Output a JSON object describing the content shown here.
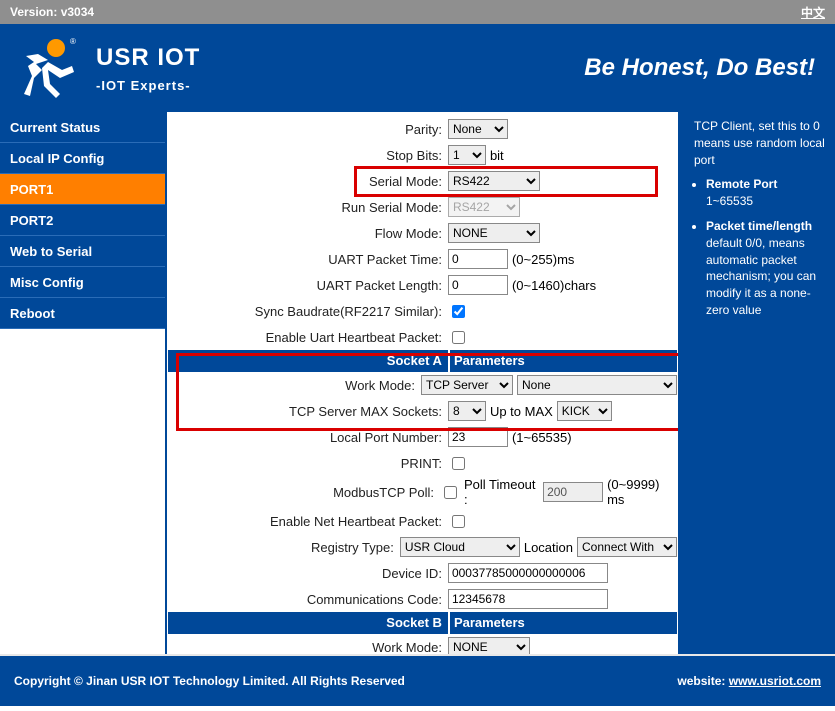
{
  "topbar": {
    "version_label": "Version: ",
    "version": "v3034",
    "lang": "中文"
  },
  "brand": {
    "title": "USR IOT",
    "subtitle": "-IOT Experts-",
    "slogan": "Be Honest, Do Best!"
  },
  "sidebar": {
    "items": [
      {
        "label": "Current Status"
      },
      {
        "label": "Local IP Config"
      },
      {
        "label": "PORT1"
      },
      {
        "label": "PORT2"
      },
      {
        "label": "Web to Serial"
      },
      {
        "label": "Misc Config"
      },
      {
        "label": "Reboot"
      }
    ]
  },
  "form": {
    "parity_label": "Parity:",
    "parity_value": "None",
    "stopbits_label": "Stop Bits:",
    "stopbits_value": "1",
    "stopbits_suffix": "bit",
    "serialmode_label": "Serial Mode:",
    "serialmode_value": "RS422",
    "runserialmode_label": "Run Serial Mode:",
    "runserialmode_value": "RS422",
    "flowmode_label": "Flow Mode:",
    "flowmode_value": "NONE",
    "uartpkttime_label": "UART Packet Time:",
    "uartpkttime_value": "0",
    "uartpkttime_suffix": "(0~255)ms",
    "uartpktlen_label": "UART Packet Length:",
    "uartpktlen_value": "0",
    "uartpktlen_suffix": "(0~1460)chars",
    "syncbaud_label": "Sync Baudrate(RF2217 Similar):",
    "syncbaud_checked": true,
    "uarthb_label": "Enable Uart Heartbeat Packet:",
    "uarthb_checked": false,
    "socketA_left": "Socket A",
    "socketA_right": "Parameters",
    "workmodeA_label": "Work Mode:",
    "workmodeA_value": "TCP Server",
    "workmodeA_value2": "None",
    "tcpmax_label": "TCP Server MAX Sockets:",
    "tcpmax_value": "8",
    "tcpmax_mid": "Up to MAX",
    "tcpmax_value2": "KICK",
    "localport_label": "Local Port Number:",
    "localport_value": "23",
    "localport_suffix": "(1~65535)",
    "print_label": "PRINT:",
    "print_checked": false,
    "modbus_label": "ModbusTCP Poll:",
    "modbus_checked": false,
    "modbus_mid": "Poll Timeout :",
    "modbus_value": "200",
    "modbus_suffix": "(0~9999) ms",
    "nethb_label": "Enable Net Heartbeat Packet:",
    "nethb_checked": false,
    "regtype_label": "Registry Type:",
    "regtype_value": "USR Cloud",
    "regtype_mid": "Location",
    "regtype_value2": "Connect With",
    "deviceid_label": "Device ID:",
    "deviceid_value": "00037785000000000006",
    "commcode_label": "Communications Code:",
    "commcode_value": "12345678",
    "socketB_left": "Socket B",
    "socketB_right": "Parameters",
    "workmodeB_label": "Work Mode:",
    "workmodeB_value": "NONE"
  },
  "help": {
    "intro": "TCP Client, set this to 0 means use random local port",
    "remote_title": "Remote Port",
    "remote_body": "1~65535",
    "packet_title": "Packet time/length",
    "packet_body": "default 0/0, means automatic packet mechanism; you can modify it as a none-zero value"
  },
  "footer": {
    "copyright": "Copyright © Jinan USR IOT Technology Limited. All Rights Reserved",
    "website_label": "website:  ",
    "website_url": "www.usriot.com"
  }
}
